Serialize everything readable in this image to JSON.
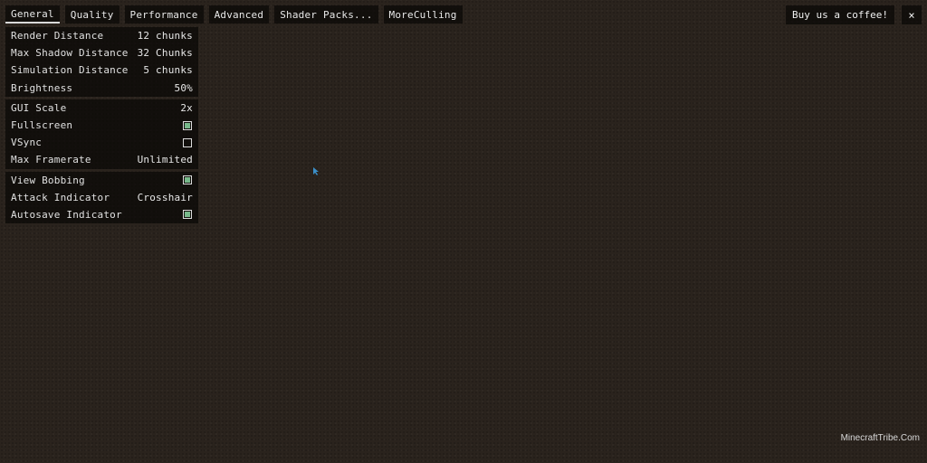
{
  "tabs": [
    {
      "label": "General",
      "active": true
    },
    {
      "label": "Quality",
      "active": false
    },
    {
      "label": "Performance",
      "active": false
    },
    {
      "label": "Advanced",
      "active": false
    },
    {
      "label": "Shader Packs...",
      "active": false
    },
    {
      "label": "MoreCulling",
      "active": false
    }
  ],
  "header": {
    "coffee_label": "Buy us a coffee!",
    "close_label": "×"
  },
  "groups": [
    {
      "rows": [
        {
          "label": "Render Distance",
          "value": "12 chunks"
        },
        {
          "label": "Max Shadow Distance",
          "value": "32 Chunks"
        },
        {
          "label": "Simulation Distance",
          "value": "5 chunks"
        },
        {
          "label": "Brightness",
          "value": "50%"
        }
      ]
    },
    {
      "rows": [
        {
          "label": "GUI Scale",
          "value": "2x"
        },
        {
          "label": "Fullscreen",
          "checked": true
        },
        {
          "label": "VSync",
          "checked": false
        },
        {
          "label": "Max Framerate",
          "value": "Unlimited"
        }
      ]
    },
    {
      "rows": [
        {
          "label": "View Bobbing",
          "checked": true
        },
        {
          "label": "Attack Indicator",
          "value": "Crosshair"
        },
        {
          "label": "Autosave Indicator",
          "checked": true
        }
      ]
    }
  ],
  "watermark": "MinecraftTribe.Com",
  "colors": {
    "background": "#2a231d",
    "panel": "#0a0806",
    "checkbox_on": "#77b88a"
  }
}
